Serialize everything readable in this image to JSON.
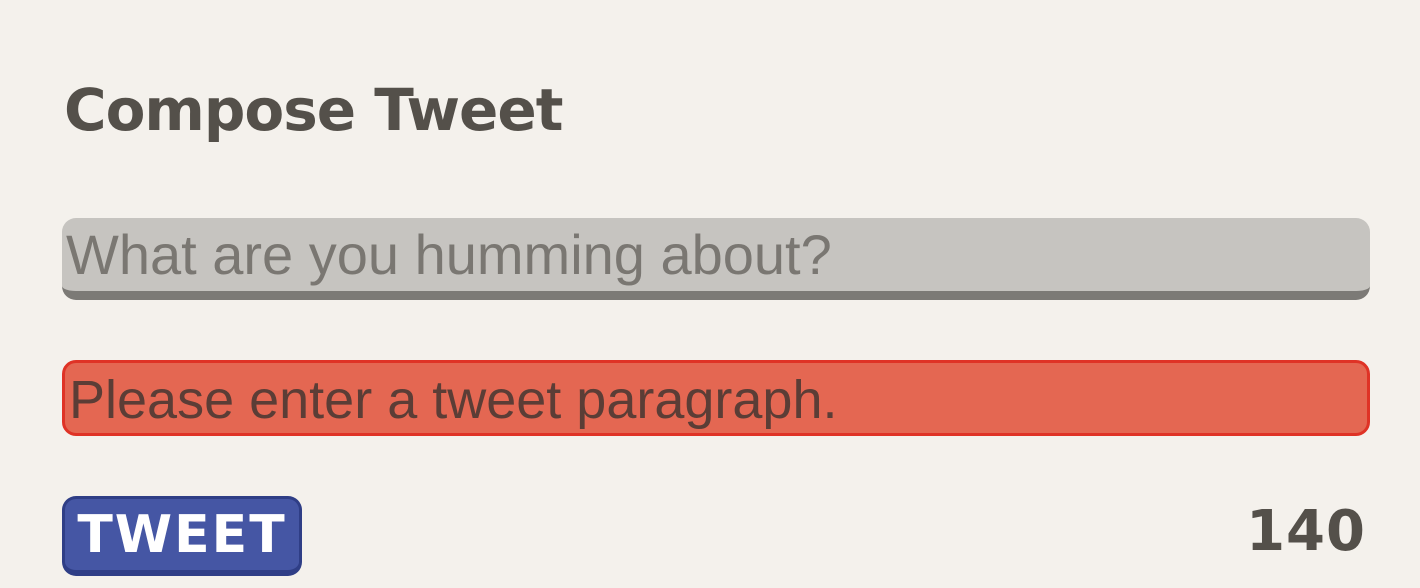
{
  "compose": {
    "title": "Compose Tweet",
    "input_value": "",
    "input_placeholder": "What are you humming about?",
    "error_message": "Please enter a tweet paragraph.",
    "submit_label": "TWEET",
    "char_count": "140"
  },
  "colors": {
    "background": "#f4f1ec",
    "input_bg": "#c6c4c0",
    "error_bg": "#e46752",
    "error_border": "#df3326",
    "button_bg": "#4556a4",
    "text_dark": "#54504a"
  }
}
